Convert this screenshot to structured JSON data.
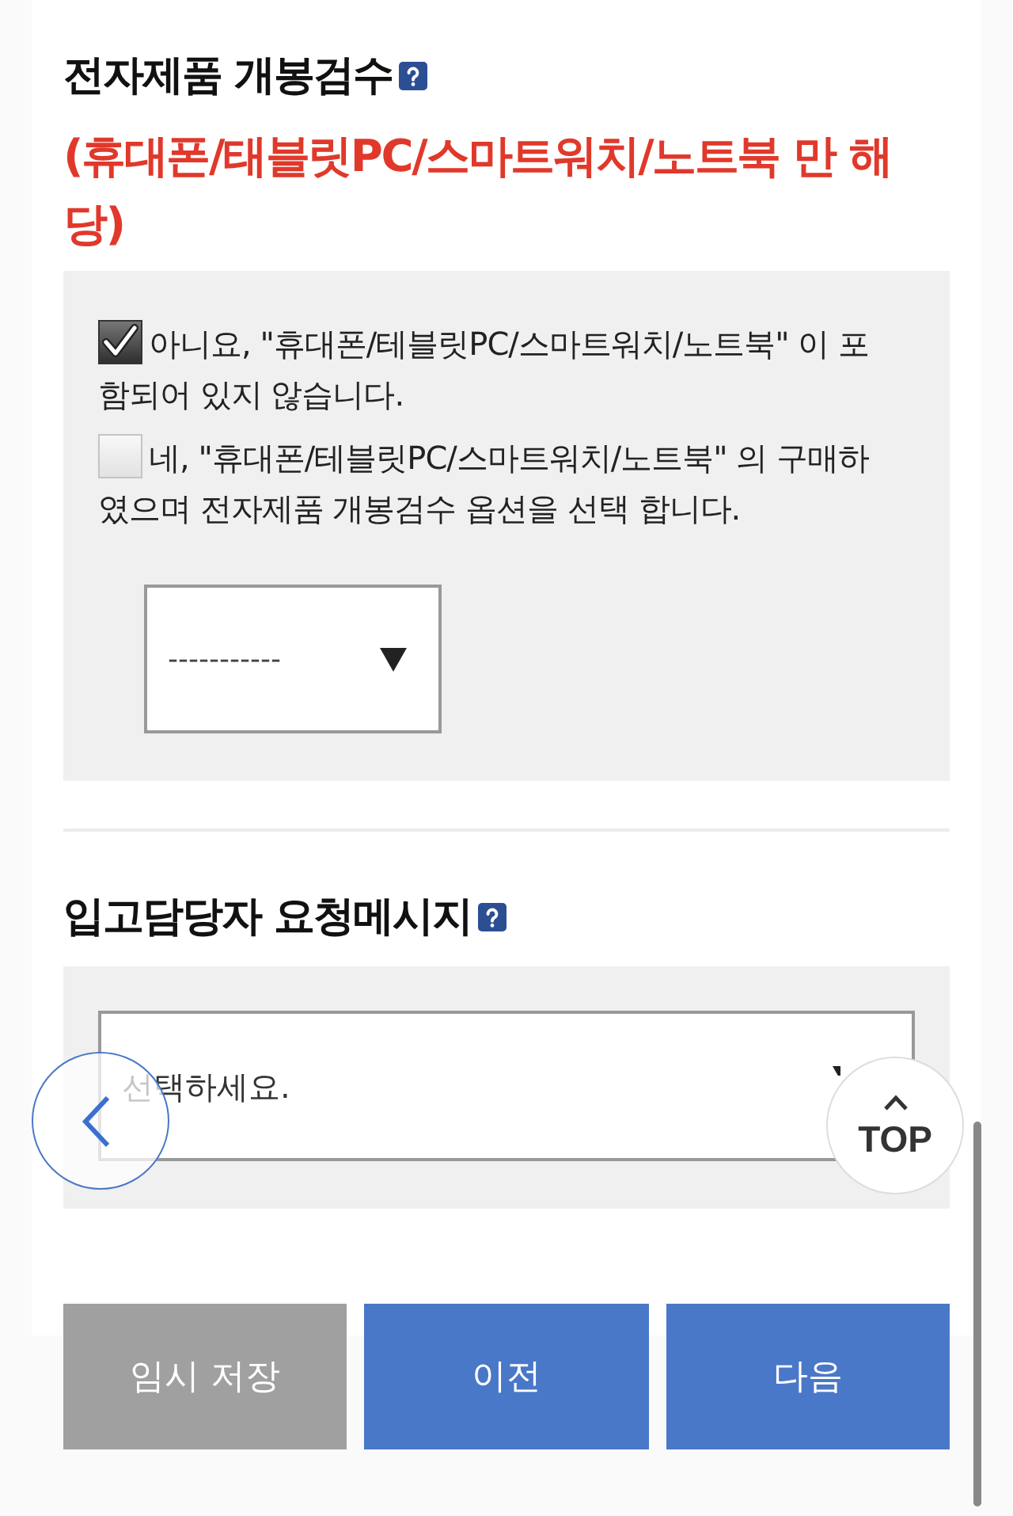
{
  "sections": [
    {
      "title": "전자제품 개봉검수",
      "note": "(휴대폰/태블릿PC/스마트워치/노트북 만 해당)",
      "options": [
        {
          "label": "아니요, \"휴대폰/테블릿PC/스마트워치/노트북\" 이 포함되어 있지 않습니다.",
          "checked": true
        },
        {
          "label": "네, \"휴대폰/테블릿PC/스마트워치/노트북\" 의 구매하였으며 전자제품 개봉검수 옵션을 선택 합니다.",
          "checked": false
        }
      ],
      "select": {
        "value": "-----------"
      }
    },
    {
      "title": "입고담당자 요청메시지",
      "select": {
        "placeholder": "선택하세요."
      }
    }
  ],
  "top_button": {
    "label": "TOP"
  },
  "buttons": [
    {
      "label": "임시 저장",
      "kind": "secondary"
    },
    {
      "label": "이전",
      "kind": "primary"
    },
    {
      "label": "다음",
      "kind": "primary"
    }
  ]
}
